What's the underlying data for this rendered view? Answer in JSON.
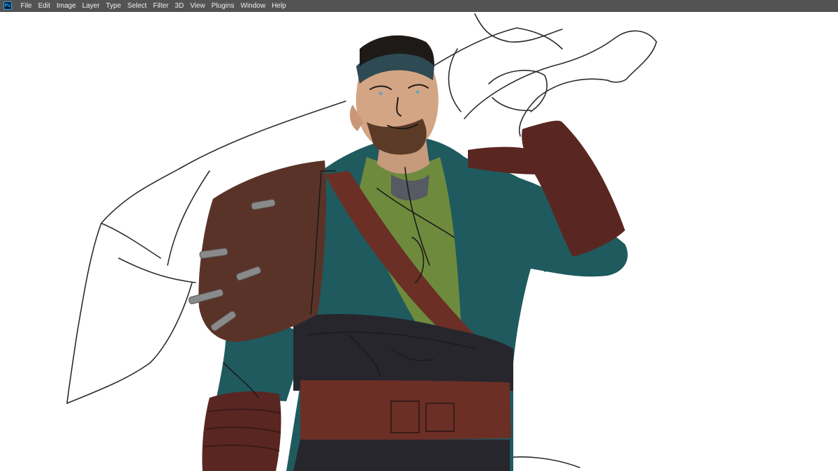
{
  "app": {
    "logo_text": "Ps",
    "icon": "photoshop-logo-icon"
  },
  "menubar": {
    "items": [
      "File",
      "Edit",
      "Image",
      "Layer",
      "Type",
      "Select",
      "Filter",
      "3D",
      "View",
      "Plugins",
      "Window",
      "Help"
    ]
  },
  "colors": {
    "menubar_bg": "#535353",
    "menu_text": "#f0f0f0",
    "canvas_bg": "#ffffff",
    "robe_teal": "#1f5a5e",
    "shirt_green": "#6e8b3d",
    "leather_brown": "#5a3328",
    "leather_dark": "#4a1f1c",
    "sash_black": "#27262d",
    "skin": "#d4a584",
    "line": "#2b2b2b"
  }
}
